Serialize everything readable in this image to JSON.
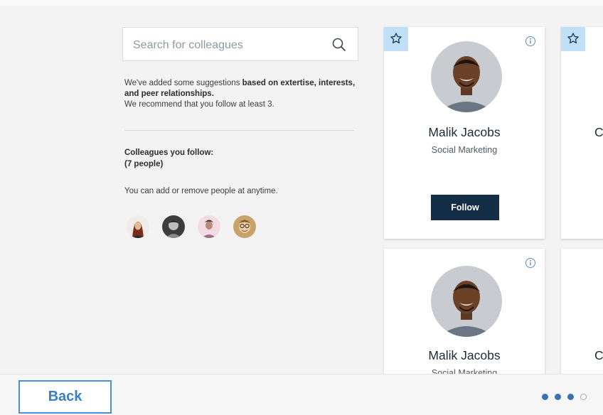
{
  "search": {
    "placeholder": "Search for colleagues",
    "icon": "search-icon"
  },
  "intro": {
    "lead": "We've added some suggestions ",
    "bold": "based on extertise, interests, and peer relationships.",
    "tail": "We recommend that you follow at least 3."
  },
  "following": {
    "title": "Colleagues you follow:",
    "count": "(7 people)",
    "note": "You can add or remove people at anytime.",
    "avatars": [
      "avatar-woman-red-hair",
      "avatar-grey-portrait",
      "avatar-man-pink",
      "avatar-man-glasses"
    ]
  },
  "cards": [
    {
      "name": "Malik Jacobs",
      "role": "Social Marketing",
      "follow_label": "Follow"
    },
    {
      "name": "Malik Jacobs",
      "role": "Social Marketing"
    }
  ],
  "partial_cards": {
    "top_letter": "C",
    "bottom_letter": "C"
  },
  "footer": {
    "back_label": "Back",
    "pagination_total": 4,
    "pagination_current": 3
  },
  "colors": {
    "accent": "#4a90d4",
    "follow_button": "#152e47",
    "star_bg": "#bfe0f6",
    "dot_active": "#3d70b2"
  }
}
